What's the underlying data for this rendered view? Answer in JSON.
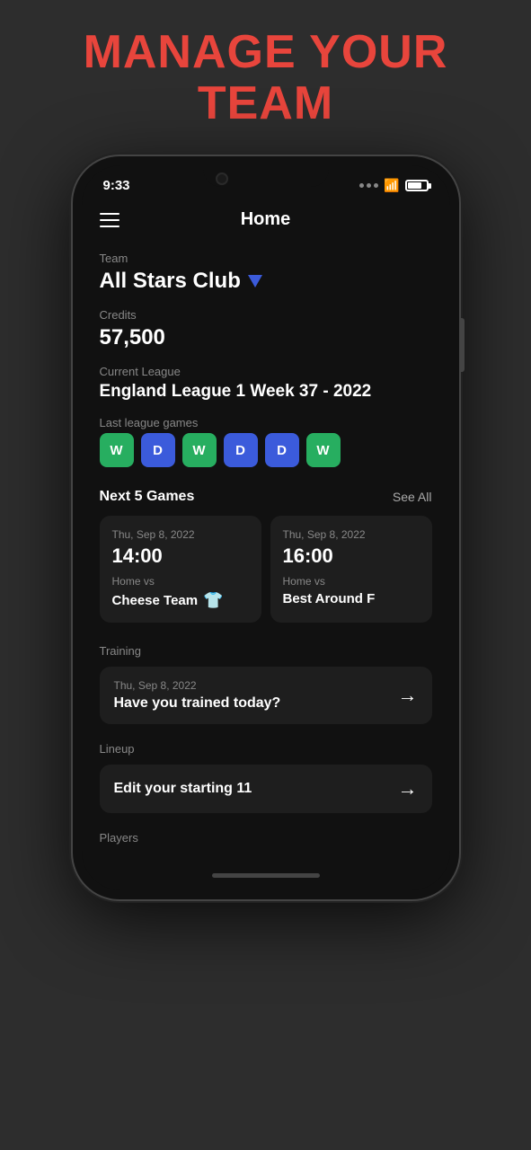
{
  "page": {
    "title_line1": "MANAGE YOUR",
    "title_line2": "TEAM",
    "title_color": "#e8453c"
  },
  "status_bar": {
    "time": "9:33",
    "wifi": "wifi",
    "battery": "battery"
  },
  "nav": {
    "title": "Home",
    "hamburger_label": "menu"
  },
  "team": {
    "label": "Team",
    "name": "All Stars Club"
  },
  "credits": {
    "label": "Credits",
    "value": "57,500"
  },
  "league": {
    "label": "Current League",
    "name": "England League 1 Week 37 - 2022"
  },
  "last_games": {
    "label": "Last league games",
    "results": [
      {
        "result": "W",
        "type": "win"
      },
      {
        "result": "D",
        "type": "draw"
      },
      {
        "result": "W",
        "type": "win"
      },
      {
        "result": "D",
        "type": "draw"
      },
      {
        "result": "D",
        "type": "draw"
      },
      {
        "result": "W",
        "type": "win"
      }
    ]
  },
  "next_games": {
    "label": "Next 5 Games",
    "see_all": "See All",
    "games": [
      {
        "date": "Thu, Sep 8, 2022",
        "time": "14:00",
        "vs_label": "Home vs",
        "team": "Cheese Team",
        "has_shirt": true,
        "shirt_color": "#27ae60"
      },
      {
        "date": "Thu, Sep 8, 2022",
        "time": "16:00",
        "vs_label": "Home vs",
        "team": "Best Around F",
        "has_shirt": false,
        "shirt_color": ""
      }
    ]
  },
  "training": {
    "label": "Training",
    "date": "Thu, Sep 8, 2022",
    "question": "Have you trained today?",
    "arrow": "→"
  },
  "lineup": {
    "label": "Lineup",
    "text": "Edit your starting 11",
    "arrow": "→"
  },
  "players": {
    "label": "Players"
  }
}
